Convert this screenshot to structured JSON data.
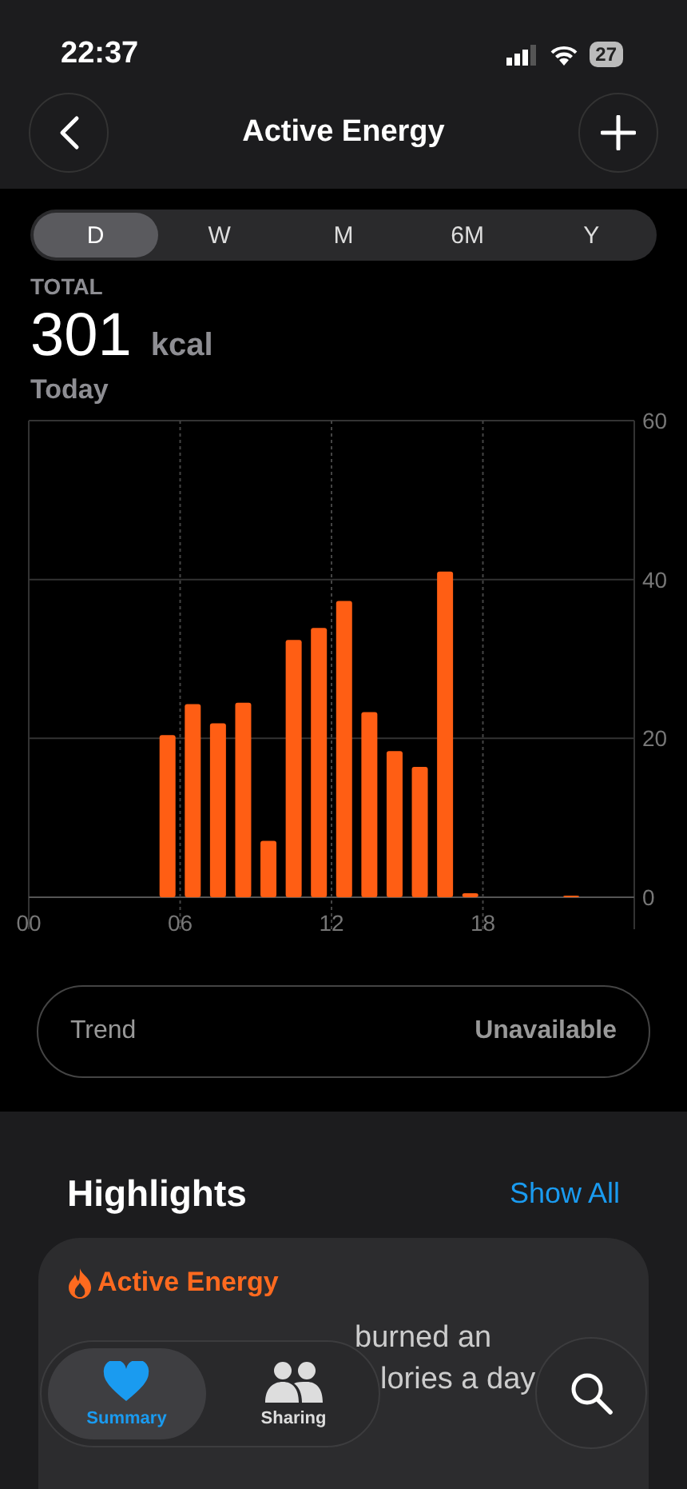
{
  "status_bar": {
    "time": "22:37",
    "battery": "27"
  },
  "nav": {
    "title": "Active Energy"
  },
  "segments": [
    {
      "label": "D",
      "selected": true
    },
    {
      "label": "W",
      "selected": false
    },
    {
      "label": "M",
      "selected": false
    },
    {
      "label": "6M",
      "selected": false
    },
    {
      "label": "Y",
      "selected": false
    }
  ],
  "summary": {
    "label": "TOTAL",
    "value": "301",
    "unit": "kcal",
    "period": "Today"
  },
  "chart_data": {
    "type": "bar",
    "x": [
      5.5,
      6.5,
      7.5,
      8.5,
      9.5,
      10.5,
      11.5,
      12.5,
      13.5,
      14.5,
      15.5,
      16.5,
      17.5,
      21.5
    ],
    "series": [
      {
        "color": "#ff5e14",
        "values": [
          20.4,
          24.3,
          21.9,
          24.5,
          7.1,
          32.4,
          33.9,
          37.3,
          23.3,
          18.4,
          16.4,
          41,
          0.5,
          0.2
        ]
      }
    ],
    "xlim": [
      0,
      24
    ],
    "ylim": [
      0,
      60
    ],
    "grid": true,
    "yticks": [
      0,
      20,
      40,
      60
    ],
    "xticks": [
      {
        "value": 0,
        "label": "00"
      },
      {
        "value": 6,
        "label": "06"
      },
      {
        "value": 12,
        "label": "12"
      },
      {
        "value": 18,
        "label": "18"
      }
    ]
  },
  "trend": {
    "label": "Trend",
    "value": "Unavailable"
  },
  "highlights": {
    "title": "Highlights",
    "action": "Show All",
    "card": {
      "title": "Active Energy",
      "lines": [
        "burned an",
        "lories a day"
      ]
    }
  },
  "tab_bar": [
    {
      "label": "Summary",
      "selected": true
    },
    {
      "label": "Sharing",
      "selected": false
    }
  ]
}
